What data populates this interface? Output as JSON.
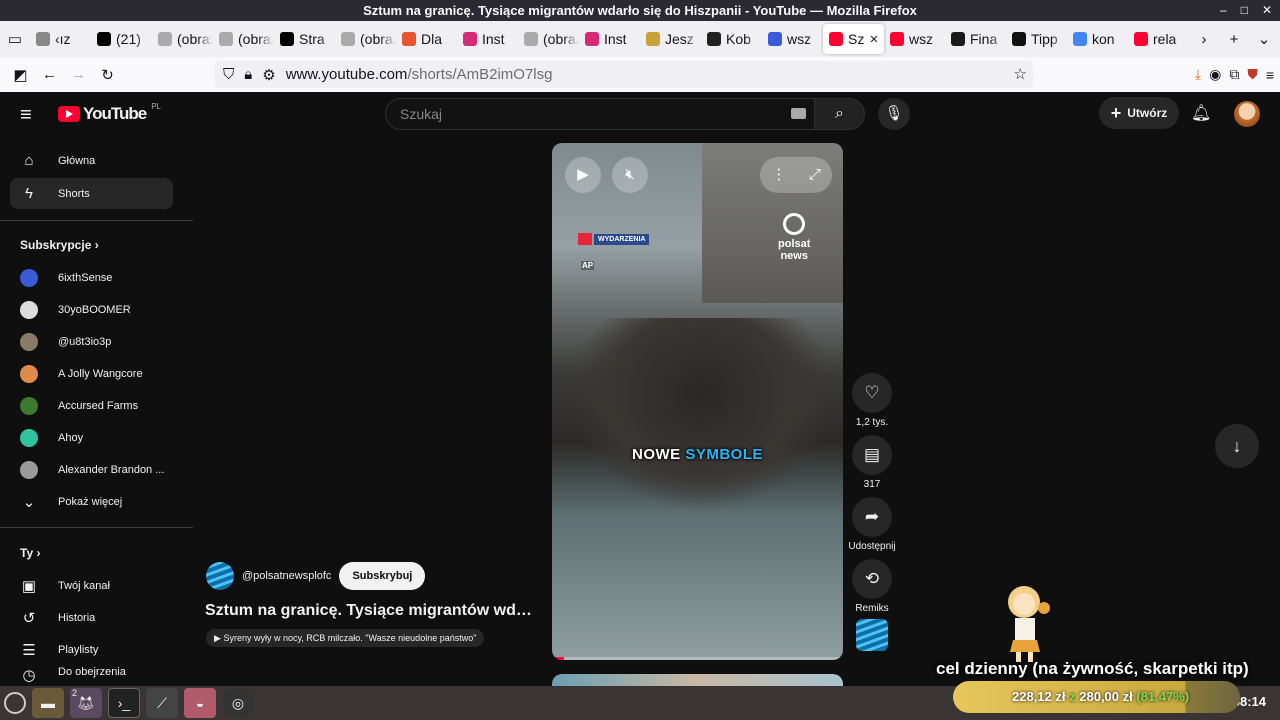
{
  "window": {
    "title": "Sztum na granicę. Tysiące migrantów wdarło się do Hiszpanii - YouTube — Mozilla Firefox"
  },
  "tabs": [
    {
      "label": "‹ız",
      "color": "#888"
    },
    {
      "label": "(21)",
      "color": "#000"
    },
    {
      "label": "(obraz",
      "color": "#aaa"
    },
    {
      "label": "(obraz",
      "color": "#aaa"
    },
    {
      "label": "Stra",
      "color": "#000"
    },
    {
      "label": "(obraz",
      "color": "#aaa"
    },
    {
      "label": "Dla",
      "color": "#e8542f"
    },
    {
      "label": "Inst",
      "color": "#d62976"
    },
    {
      "label": "(obraz",
      "color": "#aaa"
    },
    {
      "label": "Inst",
      "color": "#d62976"
    },
    {
      "label": "Jesz",
      "color": "#c9a23a"
    },
    {
      "label": "Kob",
      "color": "#222"
    },
    {
      "label": "wsz",
      "color": "#3b5bdb"
    },
    {
      "label": "Sz",
      "color": "#ff0033",
      "active": true
    },
    {
      "label": "wsz",
      "color": "#ff0033"
    },
    {
      "label": "Fina",
      "color": "#1a1a1a"
    },
    {
      "label": "Tipp",
      "color": "#111"
    },
    {
      "label": "kon",
      "color": "#4285f4"
    },
    {
      "label": "rela",
      "color": "#ff0033"
    }
  ],
  "nav": {
    "url_host": "www.youtube.com",
    "url_path": "/shorts/AmB2imO7lsg"
  },
  "masthead": {
    "logo": "YouTube",
    "region": "PL",
    "search_placeholder": "Szukaj",
    "create": "Utwórz"
  },
  "sidebar": {
    "home": "Główna",
    "shorts": "Shorts",
    "subs_header": "Subskrypcje",
    "subs": [
      {
        "name": "6ixthSense",
        "color": "#3a5bd6"
      },
      {
        "name": "30yoBOOMER",
        "color": "#dcdcdc"
      },
      {
        "name": "@u8t3io3p",
        "color": "#8a7a6a"
      },
      {
        "name": "A Jolly Wangcore",
        "color": "#e08a4a"
      },
      {
        "name": "Accursed Farms",
        "color": "#3b7a2a"
      },
      {
        "name": "Ahoy",
        "color": "#2ec4a0"
      },
      {
        "name": "Alexander Brandon ...",
        "color": "#9a9a9a"
      }
    ],
    "show_more": "Pokaż więcej",
    "you_header": "Ty",
    "you": [
      {
        "name": "Twój kanał"
      },
      {
        "name": "Historia"
      },
      {
        "name": "Playlisty"
      },
      {
        "name": "Do obejrzenia"
      }
    ]
  },
  "short": {
    "badge": "WYDARZENIA",
    "ap": "AP",
    "brand_line1": "polsat",
    "brand_line2": "news",
    "caption_w1": "NOWE",
    "caption_w2": "SYMBOLE",
    "progress": 0.04,
    "likes": "1,2 tys.",
    "comments": "317",
    "share": "Udostępnij",
    "remix": "Remiks"
  },
  "meta": {
    "channel": "@polsatnewsplofc",
    "subscribe": "Subskrybuj",
    "title": "Sztum na granicę. Tysiące migrantów wdarło się do Hiszpanii",
    "chip": "Syreny wyły w nocy, RCB milczało. \"Wasze nieudolne państwo\""
  },
  "overlay": {
    "goal_text": "cel dzienny (na żywność, skarpetki itp)",
    "current": "228,12 zł",
    "of": "z",
    "target": "280,00 zł",
    "percent": "(81.47%)",
    "fill": 0.8147
  },
  "taskbar": {
    "badge": "2",
    "clock": "23:58:14"
  }
}
